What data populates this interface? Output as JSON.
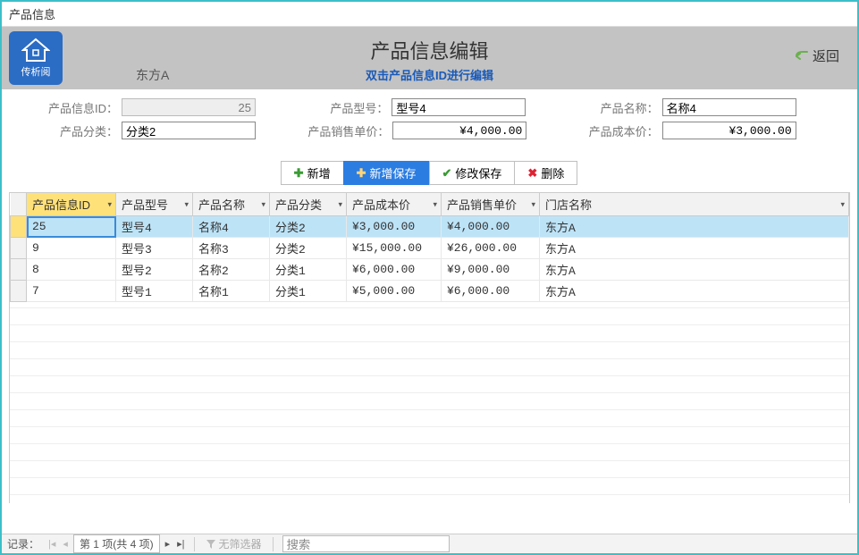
{
  "window_title": "产品信息",
  "logo_text": "传析阅",
  "store_name": "东方A",
  "main_title": "产品信息编辑",
  "sub_title": "双击产品信息ID进行编辑",
  "back_label": "返回",
  "form": {
    "id_label": "产品信息ID：",
    "id_value": "25",
    "model_label": "产品型号：",
    "model_value": "型号4",
    "name_label": "产品名称：",
    "name_value": "名称4",
    "category_label": "产品分类：",
    "category_value": "分类2",
    "saleprice_label": "产品销售单价：",
    "saleprice_value": "¥4,000.00",
    "costprice_label": "产品成本价：",
    "costprice_value": "¥3,000.00"
  },
  "toolbar": {
    "add": "新增",
    "add_save": "新增保存",
    "mod_save": "修改保存",
    "delete": "删除"
  },
  "columns": {
    "id": "产品信息ID",
    "model": "产品型号",
    "name": "产品名称",
    "category": "产品分类",
    "cost": "产品成本价",
    "sale": "产品销售单价",
    "store": "门店名称"
  },
  "rows": [
    {
      "id": "25",
      "model": "型号4",
      "name": "名称4",
      "category": "分类2",
      "cost": "¥3,000.00",
      "sale": "¥4,000.00",
      "store": "东方A"
    },
    {
      "id": "9",
      "model": "型号3",
      "name": "名称3",
      "category": "分类2",
      "cost": "¥15,000.00",
      "sale": "¥26,000.00",
      "store": "东方A"
    },
    {
      "id": "8",
      "model": "型号2",
      "name": "名称2",
      "category": "分类1",
      "cost": "¥6,000.00",
      "sale": "¥9,000.00",
      "store": "东方A"
    },
    {
      "id": "7",
      "model": "型号1",
      "name": "名称1",
      "category": "分类1",
      "cost": "¥5,000.00",
      "sale": "¥6,000.00",
      "store": "东方A"
    }
  ],
  "statusbar": {
    "record_label": "记录：",
    "page_text": "第 1 项(共 4 项)",
    "no_filter": "无筛选器",
    "search_placeholder": "搜索"
  }
}
